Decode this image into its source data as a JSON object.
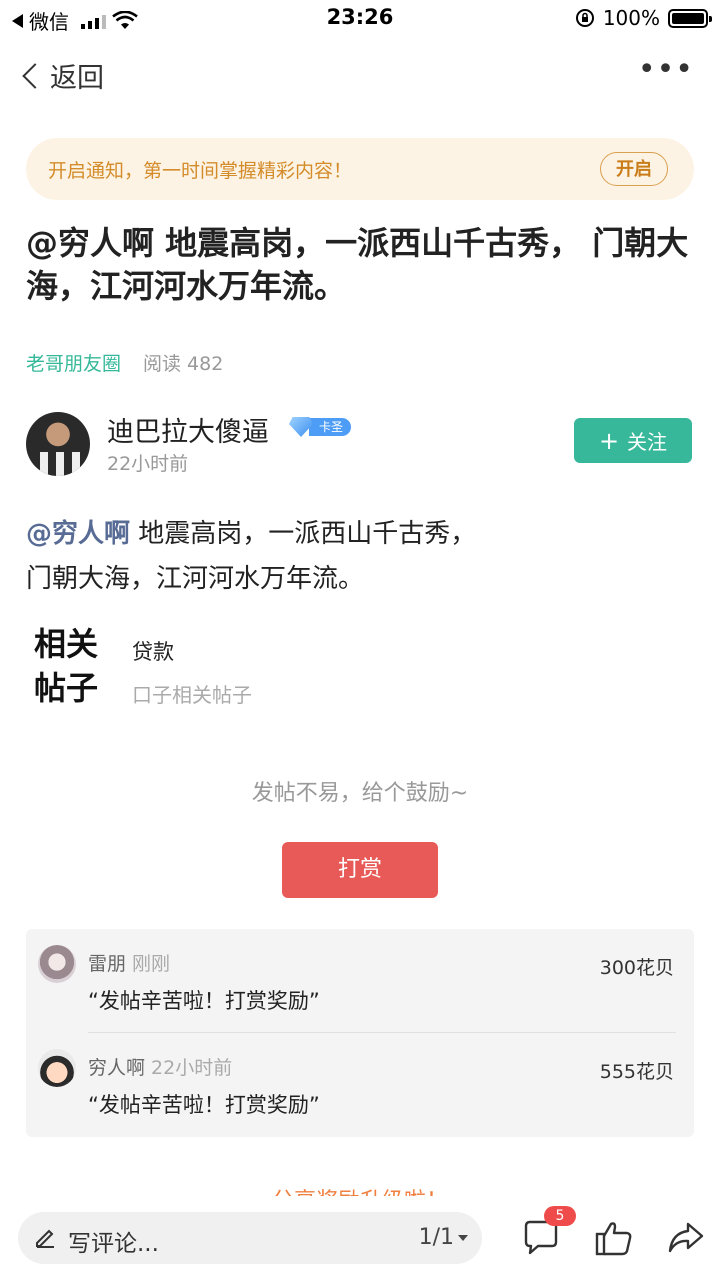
{
  "status_bar": {
    "back_app": "微信",
    "time": "23:26",
    "battery": "100%"
  },
  "nav": {
    "back_label": "返回",
    "more_label": "•••"
  },
  "notify": {
    "text": "开启通知，第一时间掌握精彩内容！",
    "button": "开启"
  },
  "post": {
    "title": "@穷人啊 地震高岗，一派西山千古秀， 门朝大海，江河河水万年流。",
    "circle": "老哥朋友圈",
    "reads": "阅读 482",
    "author": {
      "name": "迪巴拉大傻逼",
      "badge": "卡圣",
      "time": "22小时前",
      "follow_label": "关注"
    },
    "body_mention": "@穷人啊",
    "body_line1": " 地震高岗，一派西山千古秀，",
    "body_line2": "门朝大海，江河河水万年流。"
  },
  "related": {
    "logo": "相关帖子",
    "items": [
      {
        "text": "贷款"
      },
      {
        "text": "口子相关帖子"
      }
    ]
  },
  "reward": {
    "encourage": "发帖不易，给个鼓励~",
    "button": "打赏",
    "records": [
      {
        "name": "雷朋",
        "time": "刚刚",
        "amount": "300花贝",
        "message": "“发帖辛苦啦！打赏奖励”"
      },
      {
        "name": "穷人啊",
        "time": "22小时前",
        "amount": "555花贝",
        "message": "“发帖辛苦啦！打赏奖励”"
      }
    ]
  },
  "share_hint": "分享奖励升级啦！",
  "bottom_bar": {
    "comment_placeholder": "写评论...",
    "page_indicator": "1/1",
    "comment_count": "5"
  },
  "colors": {
    "accent_green": "#38b89a",
    "reward_red": "#e85a57",
    "notify_orange": "#d48c2a",
    "mention_blue": "#576b95"
  }
}
